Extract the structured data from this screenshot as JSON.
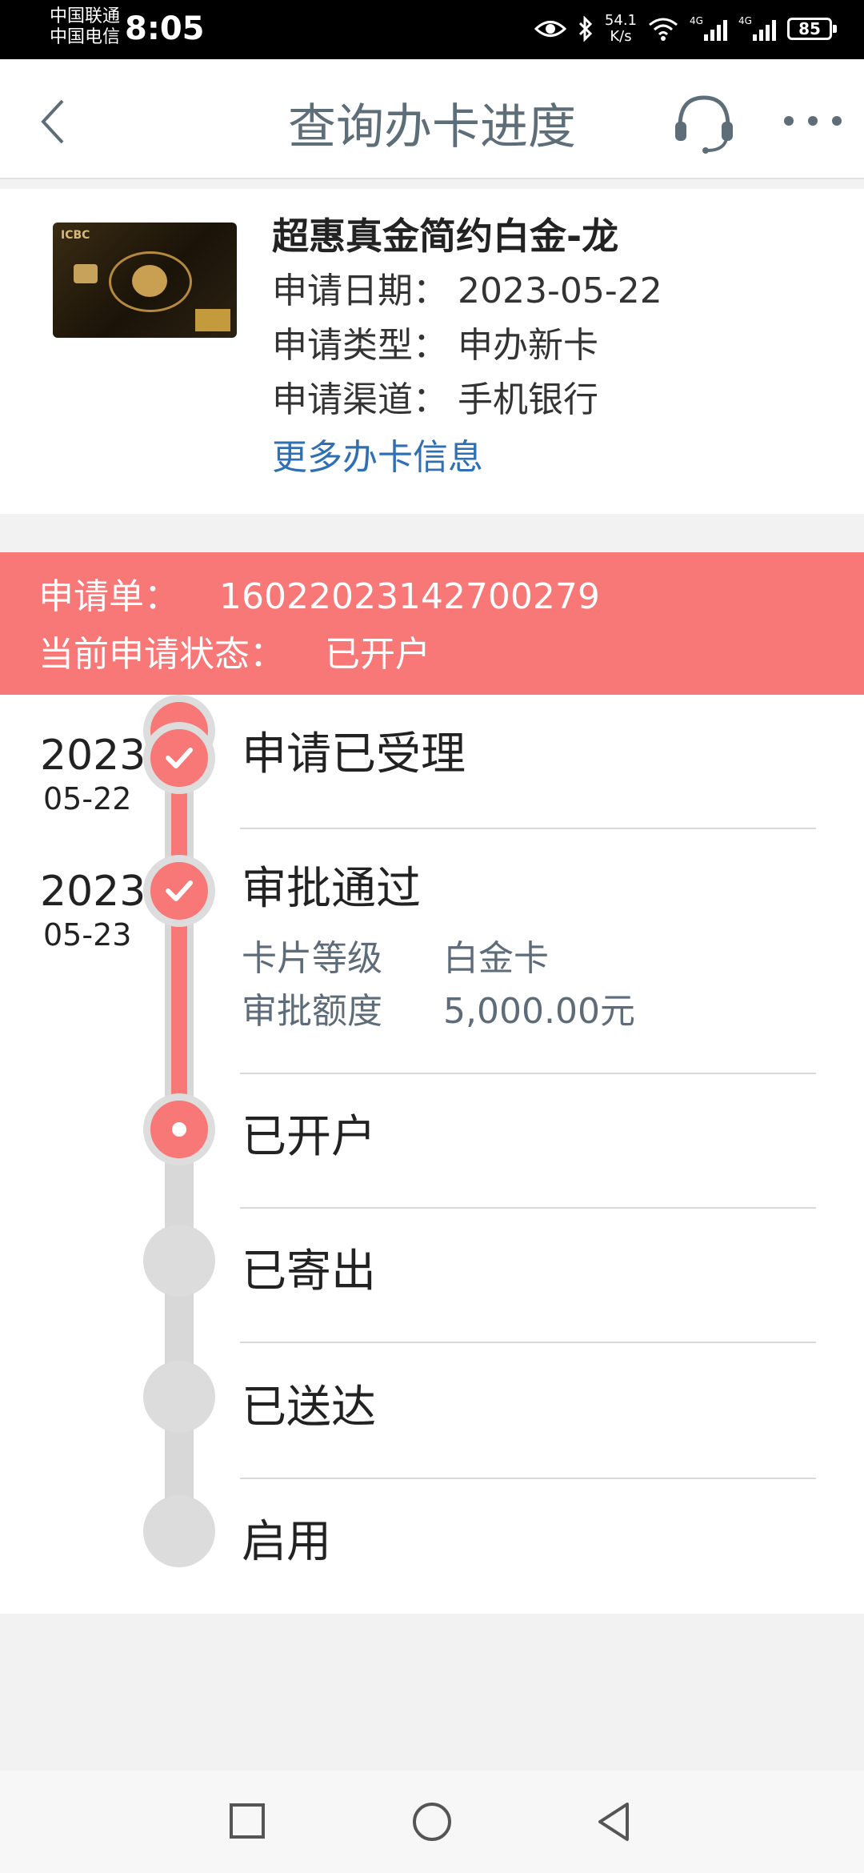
{
  "status_bar": {
    "carrier1": "中国联通",
    "carrier2": "中国电信",
    "time": "8:05",
    "net_speed_value": "54.1",
    "net_speed_unit": "K/s",
    "signal1_label": "4G",
    "signal2_label": "4G",
    "battery": "85"
  },
  "header": {
    "title": "查询办卡进度"
  },
  "card_info": {
    "name": "超惠真金简约白金-龙",
    "card_logo_text": "ICBC",
    "apply_date_label": "申请日期：",
    "apply_date": "2023-05-22",
    "apply_type_label": "申请类型：",
    "apply_type": "申办新卡",
    "apply_channel_label": "申请渠道：",
    "apply_channel": "手机银行",
    "more_link": "更多办卡信息"
  },
  "application": {
    "number_label": "申请单：",
    "number": "1602202314270027​9",
    "status_label": "当前申请状态：",
    "status": "已开户"
  },
  "timeline": {
    "steps": [
      {
        "title": "申请已受理",
        "year": "2023",
        "date": "05-22",
        "state": "done"
      },
      {
        "title": "审批通过",
        "year": "2023",
        "date": "05-23",
        "state": "done"
      },
      {
        "title": "已开户",
        "state": "current"
      },
      {
        "title": "已寄出",
        "state": "pending"
      },
      {
        "title": "已送达",
        "state": "pending"
      },
      {
        "title": "启用",
        "state": "pending"
      }
    ],
    "approval_details": {
      "level_label": "卡片等级",
      "level_value": "白金卡",
      "limit_label": "审批额度",
      "limit_value": "5,000.00元"
    }
  },
  "colors": {
    "accent": "#f87878",
    "link": "#2f6fb3",
    "title": "#5e6e78"
  }
}
